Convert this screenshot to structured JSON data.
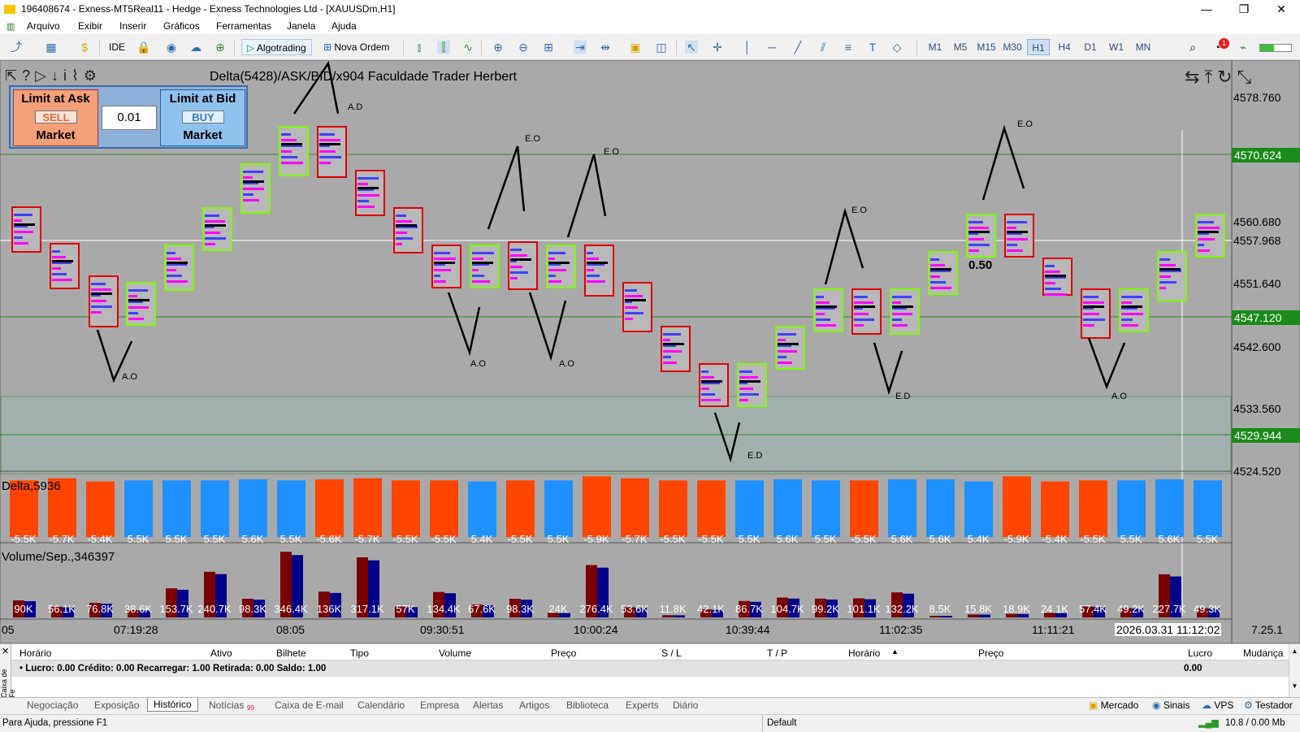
{
  "window": {
    "title": "196408674 - Exness-MT5Real11 - Hedge - Exness Technologies Ltd - [XAUUSDm,H1]",
    "minimize": "—",
    "restore": "❐",
    "close": "✕"
  },
  "menu": [
    "Arquivo",
    "Exibir",
    "Inserir",
    "Gráficos",
    "Ferramentas",
    "Janela",
    "Ajuda"
  ],
  "toolbar": {
    "ide": "IDE",
    "algotrading": "Algotrading",
    "new_order": "Nova Ordem",
    "timeframes": [
      "M1",
      "M5",
      "M15",
      "M30",
      "H1",
      "H4",
      "D1",
      "W1",
      "MN"
    ],
    "active_timeframe": "H1",
    "notif_count": "1"
  },
  "chart": {
    "indicator_name": "Delta(5428)/ASK/BID/x904   Faculdade Trader Herbert",
    "trade_panel": {
      "limit_ask": "Limit at Ask",
      "sell": "SELL",
      "market_left": "Market",
      "lot": "0.01",
      "limit_bid": "Limit at Bid",
      "buy": "BUY",
      "market_right": "Market"
    },
    "price_labels": [
      "4578.760",
      "4560.680",
      "4557.968",
      "4551.640",
      "4542.600",
      "4533.560",
      "4524.520"
    ],
    "price_boxes": [
      {
        "label": "4570.624"
      },
      {
        "label": "4547.120"
      },
      {
        "label": "4529.944"
      }
    ],
    "time_labels": [
      "05",
      "07:19:28",
      "08:05",
      "09:30:51",
      "10:00:24",
      "10:39:44",
      "11:02:35",
      "11:11:21",
      "2026.03.31 11:12:02",
      "7.25.1"
    ],
    "annotations": [
      "A.D",
      "E.O",
      "E.O",
      "E.O",
      "E.O",
      "A.O",
      "A.O",
      "A.O",
      "E.D",
      "E.D",
      "A.O"
    ],
    "value_050": "0.50",
    "colors": {
      "bg": "#a9a9a9",
      "buy": "#1e90ff",
      "sell": "#ff4500",
      "grid": "#2e8b2e",
      "box_red": "#e00000",
      "box_green": "#7cfc00"
    }
  },
  "chart_data": [
    {
      "type": "bar",
      "title": "Delta,5936",
      "values": [
        -5.5,
        -5.7,
        -5.4,
        5.5,
        5.5,
        5.5,
        5.6,
        5.5,
        -5.6,
        -5.7,
        -5.5,
        -5.5,
        5.4,
        -5.5,
        5.5,
        -5.9,
        -5.7,
        -5.5,
        -5.5,
        5.5,
        5.6,
        5.5,
        -5.5,
        5.6,
        5.6,
        5.4,
        -5.9,
        -5.4,
        -5.5,
        5.5,
        5.6,
        5.5
      ],
      "labels": [
        "-5.5K",
        "-5.7K",
        "-5.4K",
        "5.5K",
        "5.5K",
        "5.5K",
        "5.6K",
        "5.5K",
        "-5.6K",
        "-5.7K",
        "-5.5K",
        "-5.5K",
        "5.4K",
        "-5.5K",
        "5.5K",
        "-5.9K",
        "-5.7K",
        "-5.5K",
        "-5.5K",
        "5.5K",
        "5.6K",
        "5.5K",
        "-5.5K",
        "5.6K",
        "5.6K",
        "5.4K",
        "-5.9K",
        "-5.4K",
        "-5.5K",
        "5.5K",
        "5.6K",
        "5.5K"
      ]
    },
    {
      "type": "bar",
      "title": "Volume/Sep.,346397",
      "values": [
        90,
        56.1,
        76.8,
        38.6,
        153.7,
        240.7,
        98.3,
        346.4,
        136,
        317.1,
        57,
        134.4,
        67.6,
        98.3,
        24,
        276.4,
        53.6,
        11.8,
        42.1,
        86.7,
        104.7,
        99.2,
        101.1,
        132.2,
        8.5,
        15.8,
        18.9,
        24.1,
        57.4,
        49.2,
        227.7,
        49.3
      ],
      "labels": [
        "90K",
        "56.1K",
        "76.8K",
        "38.6K",
        "153.7K",
        "240.7K",
        "98.3K",
        "346.4K",
        "136K",
        "317.1K",
        "57K",
        "134.4K",
        "67.6K",
        "98.3K",
        "24K",
        "276.4K",
        "53.6K",
        "11.8K",
        "42.1K",
        "86.7K",
        "104.7K",
        "99.2K",
        "101.1K",
        "132.2K",
        "8.5K",
        "15.8K",
        "18.9K",
        "24.1K",
        "57.4K",
        "49.2K",
        "227.7K",
        "49.3K"
      ]
    }
  ],
  "toolbox": {
    "side_label": "Caixa de Fe",
    "columns": [
      "Horário",
      "Ativo",
      "Bilhete",
      "Tipo",
      "Volume",
      "Preço",
      "S / L",
      "T / P",
      "Horário",
      "Preço",
      "Lucro",
      "Mudança"
    ],
    "summary": "•  Lucro: 0.00  Crédito: 0.00  Recarregar: 1.00  Retirada: 0.00  Saldo: 1.00",
    "summary_value": "0.00"
  },
  "tabs": [
    {
      "label": "Negociação"
    },
    {
      "label": "Exposição"
    },
    {
      "label": "Histórico",
      "active": true
    },
    {
      "label": "Notícias",
      "badge": "99"
    },
    {
      "label": "Caixa de E-mail"
    },
    {
      "label": "Calendário"
    },
    {
      "label": "Empresa"
    },
    {
      "label": "Alertas"
    },
    {
      "label": "Artigos"
    },
    {
      "label": "Biblioteca"
    },
    {
      "label": "Experts"
    },
    {
      "label": "Diário"
    }
  ],
  "tabs_right": [
    "Mercado",
    "Sinais",
    "VPS",
    "Testador"
  ],
  "status": {
    "help": "Para Ajuda, pressione F1",
    "profile": "Default",
    "traffic": "10.8 / 0.00 Mb"
  }
}
